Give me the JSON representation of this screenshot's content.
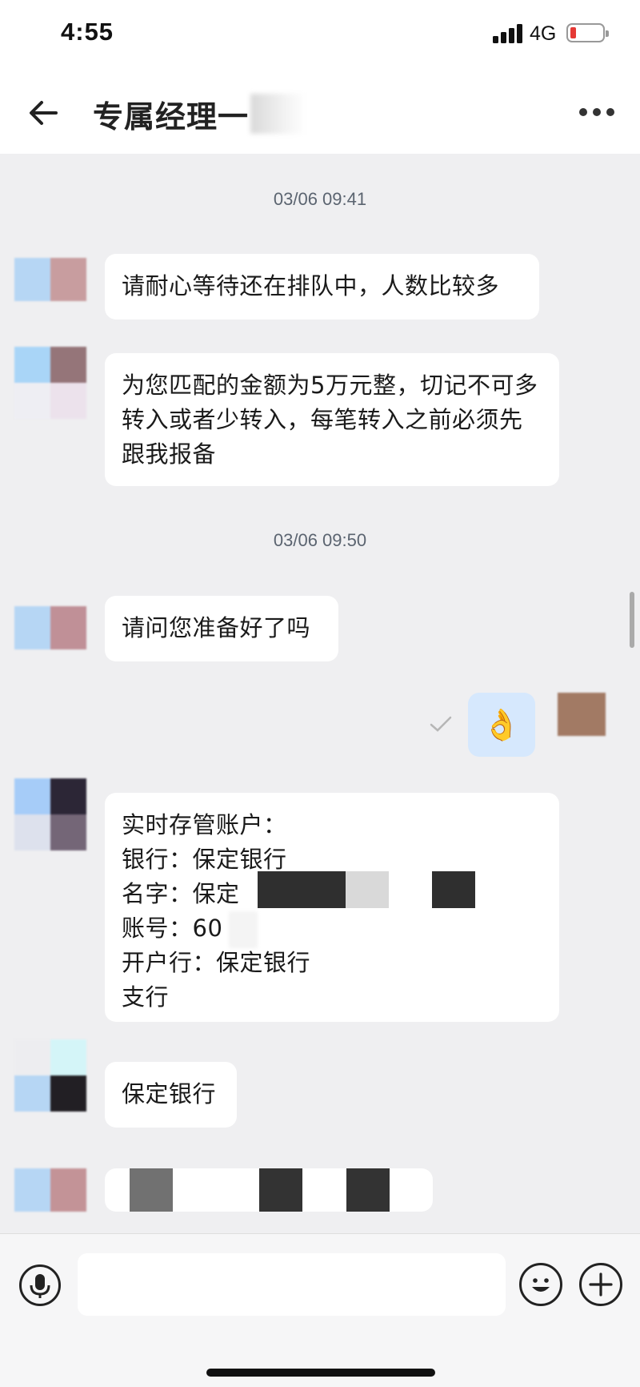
{
  "status_bar": {
    "time": "4:55",
    "network": "4G",
    "battery_color": "#e53935"
  },
  "header": {
    "title": "专属经理一",
    "back_icon": "arrow-left-icon",
    "more_icon": "more-dots-icon"
  },
  "chat": {
    "timestamps": [
      "03/06 09:41",
      "03/06 09:50"
    ],
    "messages": [
      {
        "from": "agent",
        "text": "请耐心等待还在排队中，人数比较多"
      },
      {
        "from": "agent",
        "text": "为您匹配的金额为5万元整，切记不可多转入或者少转入，每笔转入之前必须先跟我报备"
      },
      {
        "from": "agent",
        "text": "请问您准备好了吗"
      },
      {
        "from": "self",
        "emoji": "👌",
        "status_icon": "sent-check-icon"
      },
      {
        "from": "agent",
        "text": "实时存管账户：\n银行：保定银行\n名字：保定\n账号：60\n开户行：保定银行\n支行"
      },
      {
        "from": "agent",
        "text": "保定银行"
      }
    ]
  },
  "input_bar": {
    "placeholder": "",
    "voice_icon": "microphone-icon",
    "emoji_icon": "smiley-icon",
    "plus_icon": "plus-icon"
  }
}
